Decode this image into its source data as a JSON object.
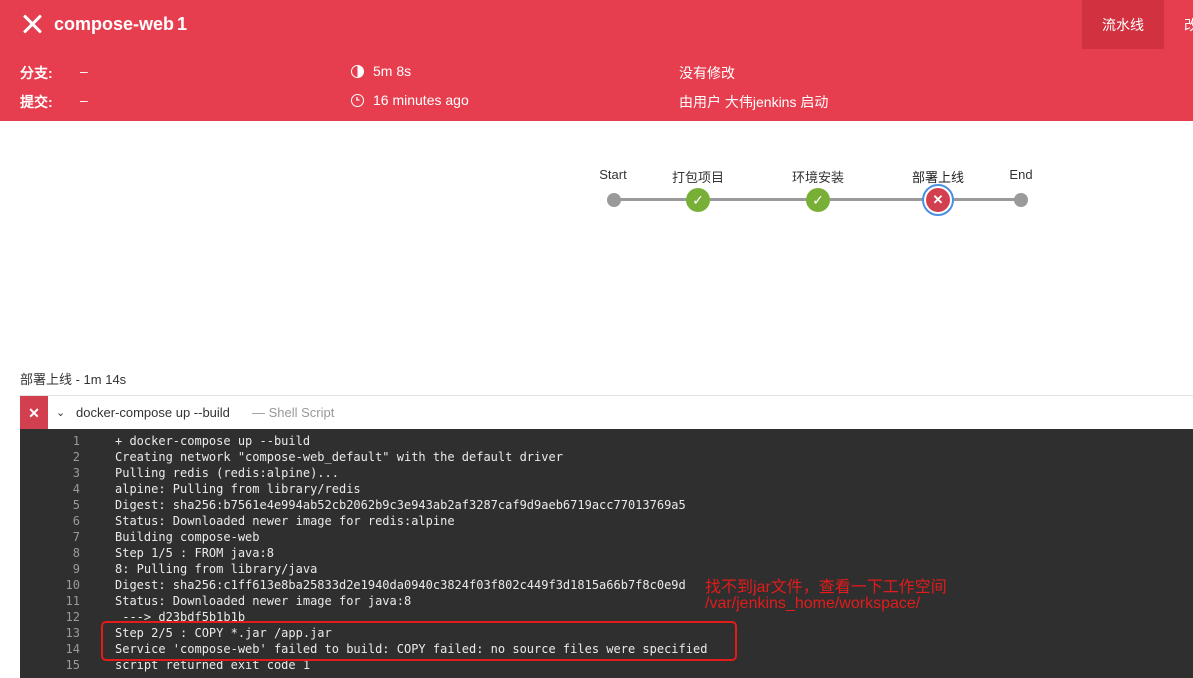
{
  "header": {
    "job_name": "compose-web",
    "run_number": "1",
    "tabs": [
      "流水线",
      "改"
    ]
  },
  "meta": {
    "branch_label": "分支:",
    "branch_value": "–",
    "commit_label": "提交:",
    "commit_value": "–",
    "duration": "5m 8s",
    "time_ago": "16 minutes ago",
    "changes": "没有修改",
    "started_by": "由用户 大伟jenkins 启动"
  },
  "pipeline": {
    "stages": [
      {
        "label": "Start",
        "status": "start"
      },
      {
        "label": "打包项目",
        "status": "success"
      },
      {
        "label": "环境安装",
        "status": "success"
      },
      {
        "label": "部署上线",
        "status": "failed"
      },
      {
        "label": "End",
        "status": "end"
      }
    ]
  },
  "stage_detail": {
    "heading": "部署上线 - 1m 14s",
    "step_name": "docker-compose up --build",
    "step_type": "— Shell Script"
  },
  "log": [
    {
      "n": "1",
      "t": "+ docker-compose up --build"
    },
    {
      "n": "2",
      "t": "Creating network \"compose-web_default\" with the default driver"
    },
    {
      "n": "3",
      "t": "Pulling redis (redis:alpine)..."
    },
    {
      "n": "4",
      "t": "alpine: Pulling from library/redis"
    },
    {
      "n": "5",
      "t": "Digest: sha256:b7561e4e994ab52cb2062b9c3e943ab2af3287caf9d9aeb6719acc77013769a5"
    },
    {
      "n": "6",
      "t": "Status: Downloaded newer image for redis:alpine"
    },
    {
      "n": "7",
      "t": "Building compose-web"
    },
    {
      "n": "8",
      "t": "Step 1/5 : FROM java:8"
    },
    {
      "n": "9",
      "t": "8: Pulling from library/java"
    },
    {
      "n": "10",
      "t": "Digest: sha256:c1ff613e8ba25833d2e1940da0940c3824f03f802c449f3d1815a66b7f8c0e9d"
    },
    {
      "n": "11",
      "t": "Status: Downloaded newer image for java:8"
    },
    {
      "n": "12",
      "t": " ---> d23bdf5b1b1b"
    },
    {
      "n": "13",
      "t": "Step 2/5 : COPY *.jar /app.jar"
    },
    {
      "n": "14",
      "t": "Service 'compose-web' failed to build: COPY failed: no source files were specified"
    },
    {
      "n": "15",
      "t": "script returned exit code 1"
    }
  ],
  "annotation": {
    "line1": "找不到jar文件，查看一下工作空间",
    "line2": "/var/jenkins_home/workspace/"
  },
  "colors": {
    "header_red": "#e63e4f",
    "success_green": "#78b037",
    "failed_red": "#d24050",
    "selected_ring": "#4a90e2",
    "annotation_red": "#e21b1b"
  }
}
